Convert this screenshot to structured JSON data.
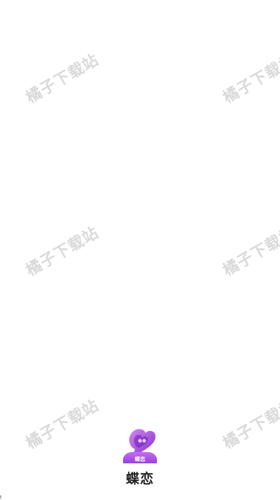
{
  "watermark": {
    "text": "橘子下载站"
  },
  "splash": {
    "logo_caption": "蝶恋",
    "app_name": "蝶恋"
  },
  "corner_mark": "t",
  "colors": {
    "background": "#ffffff",
    "brand_purple": "#a24ad8",
    "watermark_gray": "#d4d4d4"
  },
  "icons": {
    "logo": "heart-speech-bubble-icon"
  }
}
